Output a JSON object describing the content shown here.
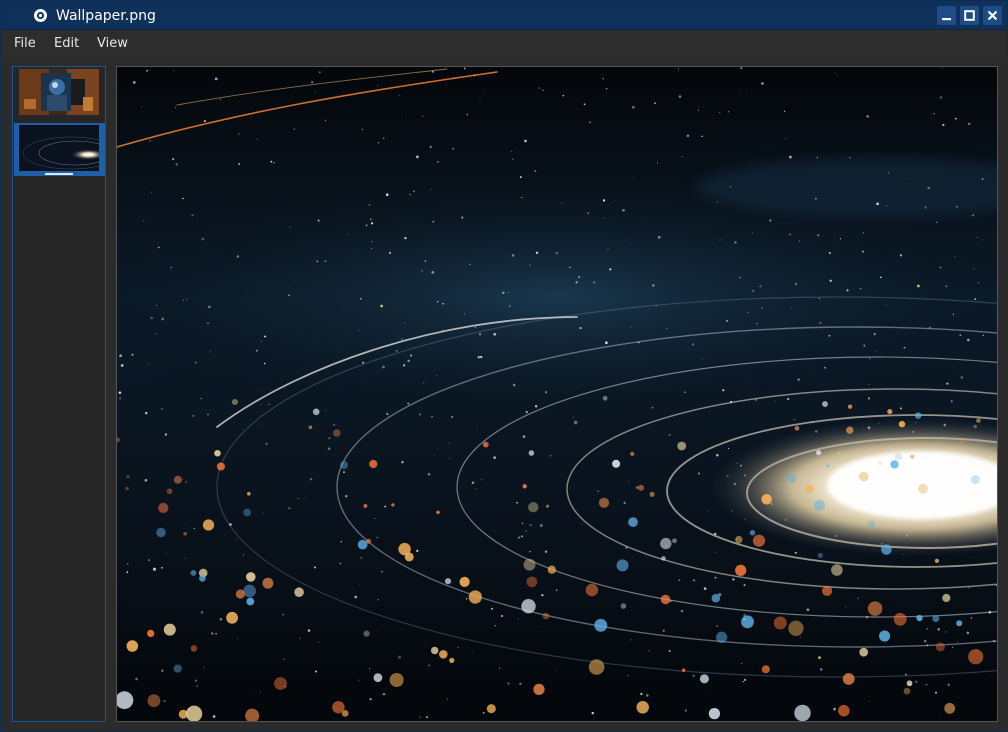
{
  "window": {
    "title": "Wallpaper.png",
    "app_icon": "image-viewer-icon",
    "controls": [
      "minimize-icon",
      "maximize-icon",
      "close-icon"
    ]
  },
  "menubar": {
    "items": [
      {
        "label": "File"
      },
      {
        "label": "Edit"
      },
      {
        "label": "View"
      }
    ]
  },
  "sidebar": {
    "thumbnails": [
      {
        "name": "thumbnail-robot-image",
        "selected": false
      },
      {
        "name": "thumbnail-galaxy-image",
        "selected": true
      }
    ]
  },
  "colors": {
    "titlebar": "#0f305a",
    "accent": "#1e5fa8",
    "background": "#2b2b2b"
  }
}
